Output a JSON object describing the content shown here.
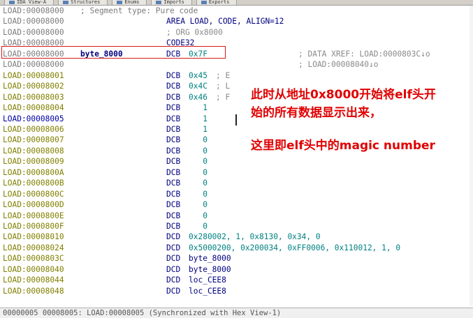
{
  "tabs": [
    {
      "label": "IDA View-A"
    },
    {
      "label": "Structures"
    },
    {
      "label": "Enums"
    },
    {
      "label": "Imports"
    },
    {
      "label": "Exports"
    }
  ],
  "listing": {
    "header": {
      "addr": "LOAD:00008000",
      "comment": "; Segment type: Pure code"
    },
    "rows": [
      {
        "addr": "LOAD:00008000",
        "label": "",
        "mnem": "AREA LOAD, CODE, ALIGN=12",
        "ops": "",
        "cmt": ""
      },
      {
        "addr": "LOAD:00008000",
        "label": "",
        "mnem": "; ORG 0x8000",
        "ops": "",
        "cmt": ""
      },
      {
        "addr": "LOAD:00008000",
        "label": "",
        "mnem": "CODE32",
        "ops": "",
        "cmt": ""
      },
      {
        "addr": "LOAD:00008000",
        "label": "byte_8000",
        "mnem": "DCB",
        "ops": "0x7F",
        "cmt": "",
        "xref": "; DATA XREF: LOAD:0000803C↓o"
      },
      {
        "addr": "LOAD:00008000",
        "label": "",
        "mnem": "",
        "ops": "",
        "cmt": "",
        "xref": "; LOAD:00008040↓o"
      },
      {
        "addr": "LOAD:00008001",
        "label": "",
        "mnem": "DCB",
        "ops": "0x45",
        "cmt": "; E"
      },
      {
        "addr": "LOAD:00008002",
        "label": "",
        "mnem": "DCB",
        "ops": "0x4C",
        "cmt": "; L"
      },
      {
        "addr": "LOAD:00008003",
        "label": "",
        "mnem": "DCB",
        "ops": "0x46",
        "cmt": "; F"
      },
      {
        "addr": "LOAD:00008004",
        "label": "",
        "mnem": "DCB",
        "ops": "   1",
        "cmt": ""
      },
      {
        "addr": "LOAD:00008005",
        "label": "",
        "mnem": "DCB",
        "ops": "   1",
        "cmt": ""
      },
      {
        "addr": "LOAD:00008006",
        "label": "",
        "mnem": "DCB",
        "ops": "   1",
        "cmt": ""
      },
      {
        "addr": "LOAD:00008007",
        "label": "",
        "mnem": "DCB",
        "ops": "   0",
        "cmt": ""
      },
      {
        "addr": "LOAD:00008008",
        "label": "",
        "mnem": "DCB",
        "ops": "   0",
        "cmt": ""
      },
      {
        "addr": "LOAD:00008009",
        "label": "",
        "mnem": "DCB",
        "ops": "   0",
        "cmt": ""
      },
      {
        "addr": "LOAD:0000800A",
        "label": "",
        "mnem": "DCB",
        "ops": "   0",
        "cmt": ""
      },
      {
        "addr": "LOAD:0000800B",
        "label": "",
        "mnem": "DCB",
        "ops": "   0",
        "cmt": ""
      },
      {
        "addr": "LOAD:0000800C",
        "label": "",
        "mnem": "DCB",
        "ops": "   0",
        "cmt": ""
      },
      {
        "addr": "LOAD:0000800D",
        "label": "",
        "mnem": "DCB",
        "ops": "   0",
        "cmt": ""
      },
      {
        "addr": "LOAD:0000800E",
        "label": "",
        "mnem": "DCB",
        "ops": "   0",
        "cmt": ""
      },
      {
        "addr": "LOAD:0000800F",
        "label": "",
        "mnem": "DCB",
        "ops": "   0",
        "cmt": ""
      },
      {
        "addr": "LOAD:00008010",
        "label": "",
        "mnem": "DCD",
        "ops": "0x280002, 1, 0x8130, 0x34, 0",
        "cmt": ""
      },
      {
        "addr": "LOAD:00008024",
        "label": "",
        "mnem": "DCD",
        "ops": "0x5000200, 0x200034, 0xFF0006, 0x110012, 1, 0",
        "cmt": ""
      },
      {
        "addr": "LOAD:0000803C",
        "label": "",
        "mnem": "DCD",
        "ops": "byte_8000",
        "cmt": ""
      },
      {
        "addr": "LOAD:00008040",
        "label": "",
        "mnem": "DCD",
        "ops": "byte_8000",
        "cmt": ""
      },
      {
        "addr": "LOAD:00008044",
        "label": "",
        "mnem": "DCD",
        "ops": "loc_CEE8",
        "cmt": ""
      },
      {
        "addr": "LOAD:00008048",
        "label": "",
        "mnem": "DCD",
        "ops": "loc_CEE8",
        "cmt": ""
      }
    ]
  },
  "annotation": {
    "line1": "此时从地址0x8000开始将elf头开",
    "line2": "始的所有数据显示出来，",
    "line3": "这里即elf头中的magic number"
  },
  "status": {
    "text": "00000005 00008005: LOAD:00008005 (Synchronized with Hex View-1)"
  },
  "colors": {
    "address_olive": "#808000",
    "address_blue": "#0000a8",
    "keyword_navy": "#000080",
    "number_teal": "#008080",
    "annotation_red": "#e00000",
    "highlight_box": "#d81818"
  }
}
